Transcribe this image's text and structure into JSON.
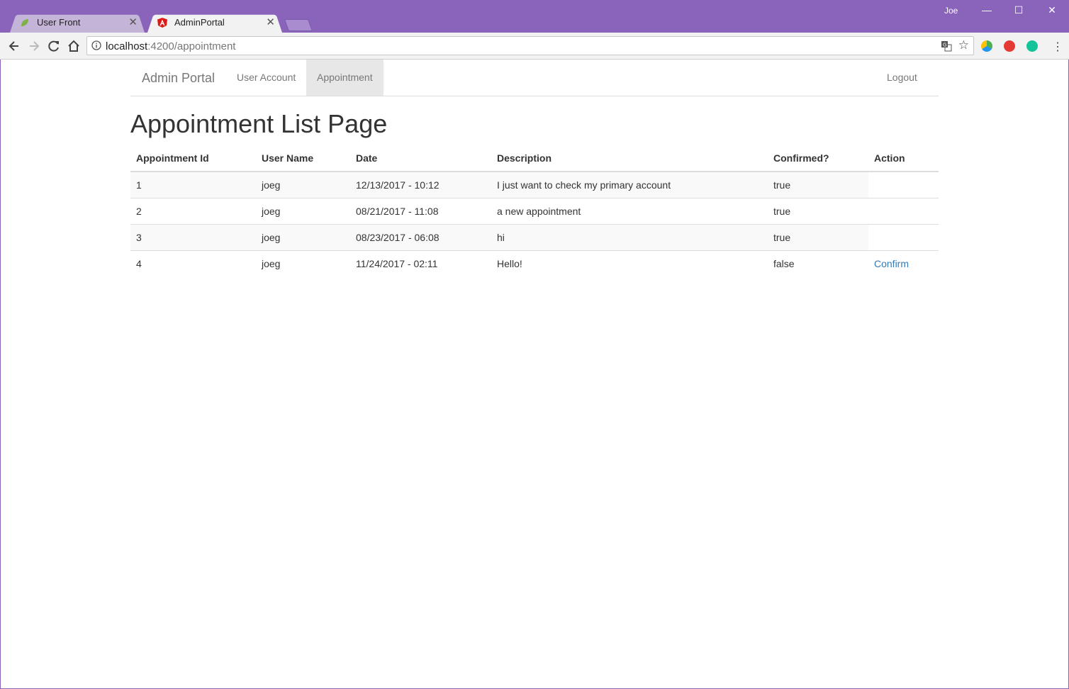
{
  "browser": {
    "tabs": [
      {
        "title": "User Front",
        "active": false
      },
      {
        "title": "AdminPortal",
        "active": true
      }
    ],
    "profile": "Joe",
    "url_host": "localhost",
    "url_path": ":4200/appointment"
  },
  "navbar": {
    "brand": "Admin Portal",
    "links": [
      "User Account",
      "Appointment"
    ],
    "logout": "Logout"
  },
  "page_title": "Appointment List Page",
  "table": {
    "headers": [
      "Appointment Id",
      "User Name",
      "Date",
      "Description",
      "Confirmed?",
      "Action"
    ],
    "rows": [
      {
        "id": "1",
        "user": "joeg",
        "date": "12/13/2017 - 10:12",
        "desc": "I just want to check my primary account",
        "confirmed": "true",
        "action": ""
      },
      {
        "id": "2",
        "user": "joeg",
        "date": "08/21/2017 - 11:08",
        "desc": "a new appointment",
        "confirmed": "true",
        "action": ""
      },
      {
        "id": "3",
        "user": "joeg",
        "date": "08/23/2017 - 06:08",
        "desc": "hi",
        "confirmed": "true",
        "action": ""
      },
      {
        "id": "4",
        "user": "joeg",
        "date": "11/24/2017 - 02:11",
        "desc": "Hello!",
        "confirmed": "false",
        "action": "Confirm"
      }
    ]
  },
  "colors": {
    "titlebar": "#8a63bb",
    "link": "#337ab7"
  }
}
